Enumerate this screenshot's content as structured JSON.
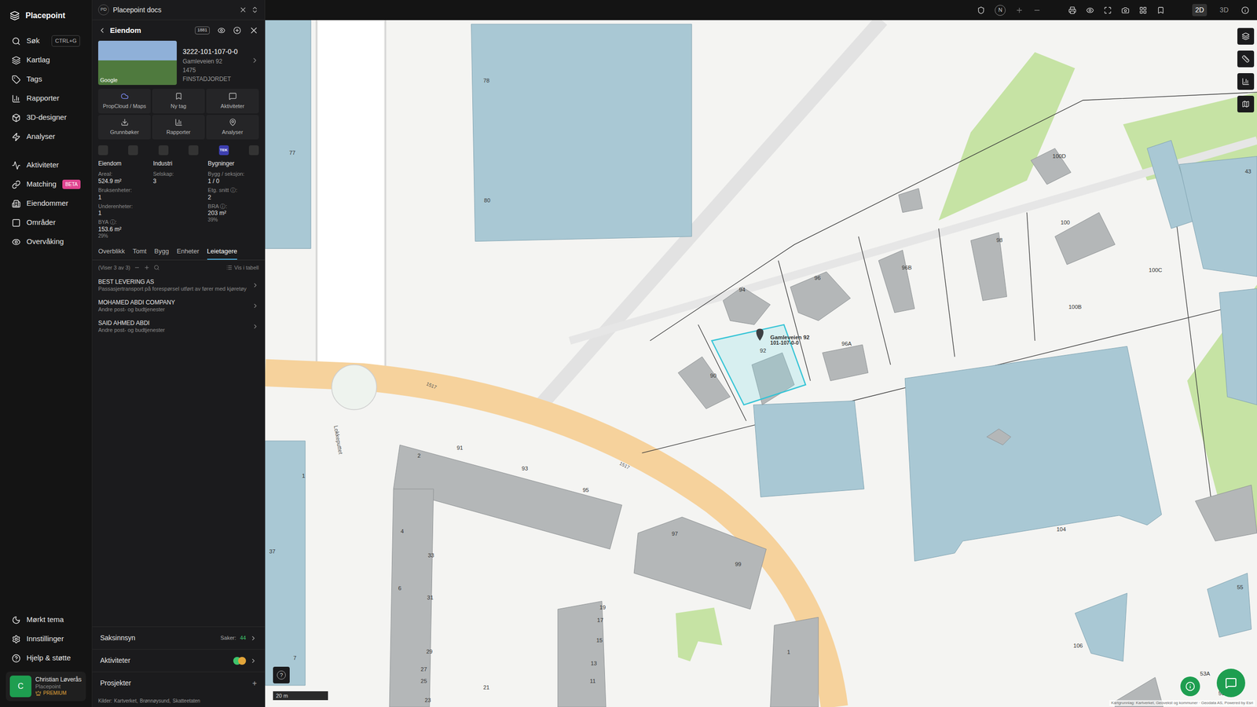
{
  "app": {
    "name": "Placepoint"
  },
  "nav": {
    "items": [
      {
        "label": "Søk",
        "shortcut": "CTRL+G"
      },
      {
        "label": "Kartlag"
      },
      {
        "label": "Tags"
      },
      {
        "label": "Rapporter"
      },
      {
        "label": "3D-designer"
      },
      {
        "label": "Analyser"
      },
      {
        "label": "Aktiviteter"
      },
      {
        "label": "Matching",
        "badge": "BETA"
      },
      {
        "label": "Eiendommer"
      },
      {
        "label": "Områder"
      },
      {
        "label": "Overvåking"
      }
    ],
    "bottom": [
      {
        "label": "Mørkt tema"
      },
      {
        "label": "Innstillinger"
      },
      {
        "label": "Hjelp & støtte"
      }
    ]
  },
  "user": {
    "initial": "C",
    "name": "Christian Løverås",
    "org": "Placepoint",
    "plan": "PREMIUM"
  },
  "docs_tab": {
    "badge": "PD",
    "title": "Placepoint docs"
  },
  "panel": {
    "title": "Eiendom",
    "badge": "1881",
    "property": {
      "id": "3222-101-107-0-0",
      "address": "Gamleveien 92",
      "postal": "1475 FINSTADJORDET",
      "photo_label": "Google"
    },
    "actions": [
      "PropCloud / Maps",
      "Ny tag",
      "Aktiviteter",
      "Grunnbøker",
      "Rapporter",
      "Analyser"
    ],
    "icon_row": [
      {
        "label": "",
        "selected": false
      },
      {
        "label": "",
        "selected": false
      },
      {
        "label": "",
        "selected": false
      },
      {
        "label": "",
        "selected": false
      },
      {
        "label": "TEK",
        "selected": true
      },
      {
        "label": "",
        "selected": false
      }
    ],
    "stats": [
      {
        "title": "Eiendom",
        "rows": [
          {
            "label": "Areal:",
            "value": "524.9 m²",
            "sub": ""
          },
          {
            "label": "Bruksenheter:",
            "value": "1",
            "sub": ""
          },
          {
            "label": "Underenheter:",
            "value": "1",
            "sub": ""
          },
          {
            "label": "BYA ⓘ:",
            "value": "153.6 m²",
            "sub": "29%"
          }
        ]
      },
      {
        "title": "Industri",
        "rows": [
          {
            "label": "Selskap:",
            "value": "3",
            "sub": ""
          }
        ]
      },
      {
        "title": "Bygninger",
        "rows": [
          {
            "label": "Bygg / seksjon:",
            "value": "1 / 0",
            "sub": ""
          },
          {
            "label": "Etg. snitt ⓘ:",
            "value": "2",
            "sub": ""
          },
          {
            "label": "BRA ⓘ:",
            "value": "203 m²",
            "sub": "39%"
          }
        ]
      }
    ],
    "tabs": [
      {
        "label": "Overblikk",
        "selected": false
      },
      {
        "label": "Tomt",
        "selected": false
      },
      {
        "label": "Bygg",
        "selected": false
      },
      {
        "label": "Enheter",
        "selected": false
      },
      {
        "label": "Leietagere",
        "selected": true
      }
    ],
    "list_info": "(Viser 3 av 3)",
    "table_button": "Vis i tabell",
    "tenants": [
      {
        "name": "BEST LEVERING AS",
        "desc": "Passasjertransport på forespørsel utført av fører med kjøretøy"
      },
      {
        "name": "MOHAMED ABDI COMPANY",
        "desc": "Andre post- og budtjenester"
      },
      {
        "name": "SAID AHMED ABDI",
        "desc": "Andre post- og budtjenester"
      }
    ],
    "sections": [
      {
        "label": "Saksinnsyn",
        "kind": "count",
        "prefix": "Saker:",
        "value": "44"
      },
      {
        "label": "Aktiviteter",
        "kind": "avatars",
        "prefix": "",
        "value": ""
      },
      {
        "label": "Prosjekter",
        "kind": "add",
        "prefix": "",
        "value": "+"
      }
    ],
    "sources": {
      "label": "Kilder:",
      "items": [
        "Kartverket,",
        "Brønnøysund,",
        "Skatteetaten"
      ]
    }
  },
  "map": {
    "toolbar": {
      "north": "N",
      "modes": [
        {
          "label": "2D",
          "selected": true
        },
        {
          "label": "3D",
          "selected": false
        }
      ]
    },
    "labels": [
      "78",
      "77",
      "80",
      "94",
      "96",
      "96B",
      "98",
      "100D",
      "100",
      "100C",
      "100B",
      "43",
      "92",
      "90",
      "96A",
      "104",
      "91",
      "93",
      "95",
      "2",
      "1",
      "4",
      "33",
      "31",
      "6",
      "29",
      "27",
      "25",
      "23",
      "21",
      "19",
      "17",
      "15",
      "13",
      "11",
      "97",
      "99",
      "1",
      "37",
      "106",
      "55",
      "53A",
      "53B",
      "7"
    ],
    "roads": [
      "1517",
      "1517"
    ],
    "street": "Lokkeputtet",
    "pin": {
      "title": "Gamleveien 92",
      "sub": "101-107-0-0"
    },
    "scale": "20 m",
    "help": "?",
    "attribution": "Kartgrunnlag: Kartverket, Geovekst og kommuner · Geodata AS, Powered by Esri"
  }
}
